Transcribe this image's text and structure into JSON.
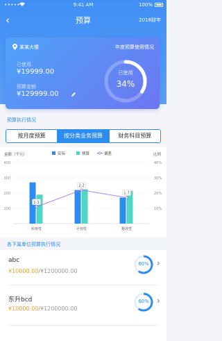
{
  "status": {
    "signal": "•••••",
    "time": "9:41 AM",
    "battery": "100%"
  },
  "nav": {
    "back": "‹",
    "title": "预算",
    "year": "2018财年"
  },
  "card": {
    "building": "某某大楼",
    "right_title": "年度预算使用情况",
    "used_label": "已使用",
    "used_value": "¥19999.00",
    "budget_label": "预算金额",
    "budget_value": "¥129999.00",
    "ring_label": "已使用",
    "ring_value": "34%",
    "ring_percent": 34
  },
  "section1": {
    "title": "预算执行情况"
  },
  "tabs": [
    {
      "label": "按月度预算",
      "active": false
    },
    {
      "label": "按分类业务预算",
      "active": true
    },
    {
      "label": "财务科目预算",
      "active": false
    }
  ],
  "chart_data": {
    "type": "bar",
    "ylabel_left": "金额（千元）",
    "ylabel_right": "比例",
    "legend": [
      "实际",
      "预算",
      "偏差"
    ],
    "categories": [
      "科目性",
      "计划性",
      "整改性"
    ],
    "series": [
      {
        "name": "实际",
        "values": [
          270,
          220,
          170
        ],
        "color": "#2d8cf0"
      },
      {
        "name": "预算",
        "values": [
          190,
          225,
          215
        ],
        "color": "#4fd6c5"
      }
    ],
    "deviation": {
      "name": "偏差",
      "values": [
        1.1,
        2.2,
        1.7
      ],
      "labels": [
        "1.1",
        "2.2",
        "1.7"
      ],
      "color": "#9b7af0"
    },
    "ylim_left": [
      0,
      400
    ],
    "yticks_left": [
      "400",
      "300",
      "200",
      "100"
    ],
    "ylim_right": [
      0,
      4
    ],
    "yticks_right": [
      "40%",
      "30%",
      "20%",
      "10%"
    ],
    "grid": true
  },
  "section2": {
    "title": "各下属单位预算执行情况"
  },
  "list": [
    {
      "name": "abc",
      "amount_used": "¥10000.00",
      "amount_total": "/¥1200000.00",
      "percent_label": "60%",
      "percent": 60,
      "chevron": "›"
    },
    {
      "name": "东升bcd",
      "amount_used": "¥10000.00",
      "amount_total": "/¥1200000.00",
      "percent_label": "60%",
      "percent": 60,
      "chevron": "›"
    }
  ]
}
